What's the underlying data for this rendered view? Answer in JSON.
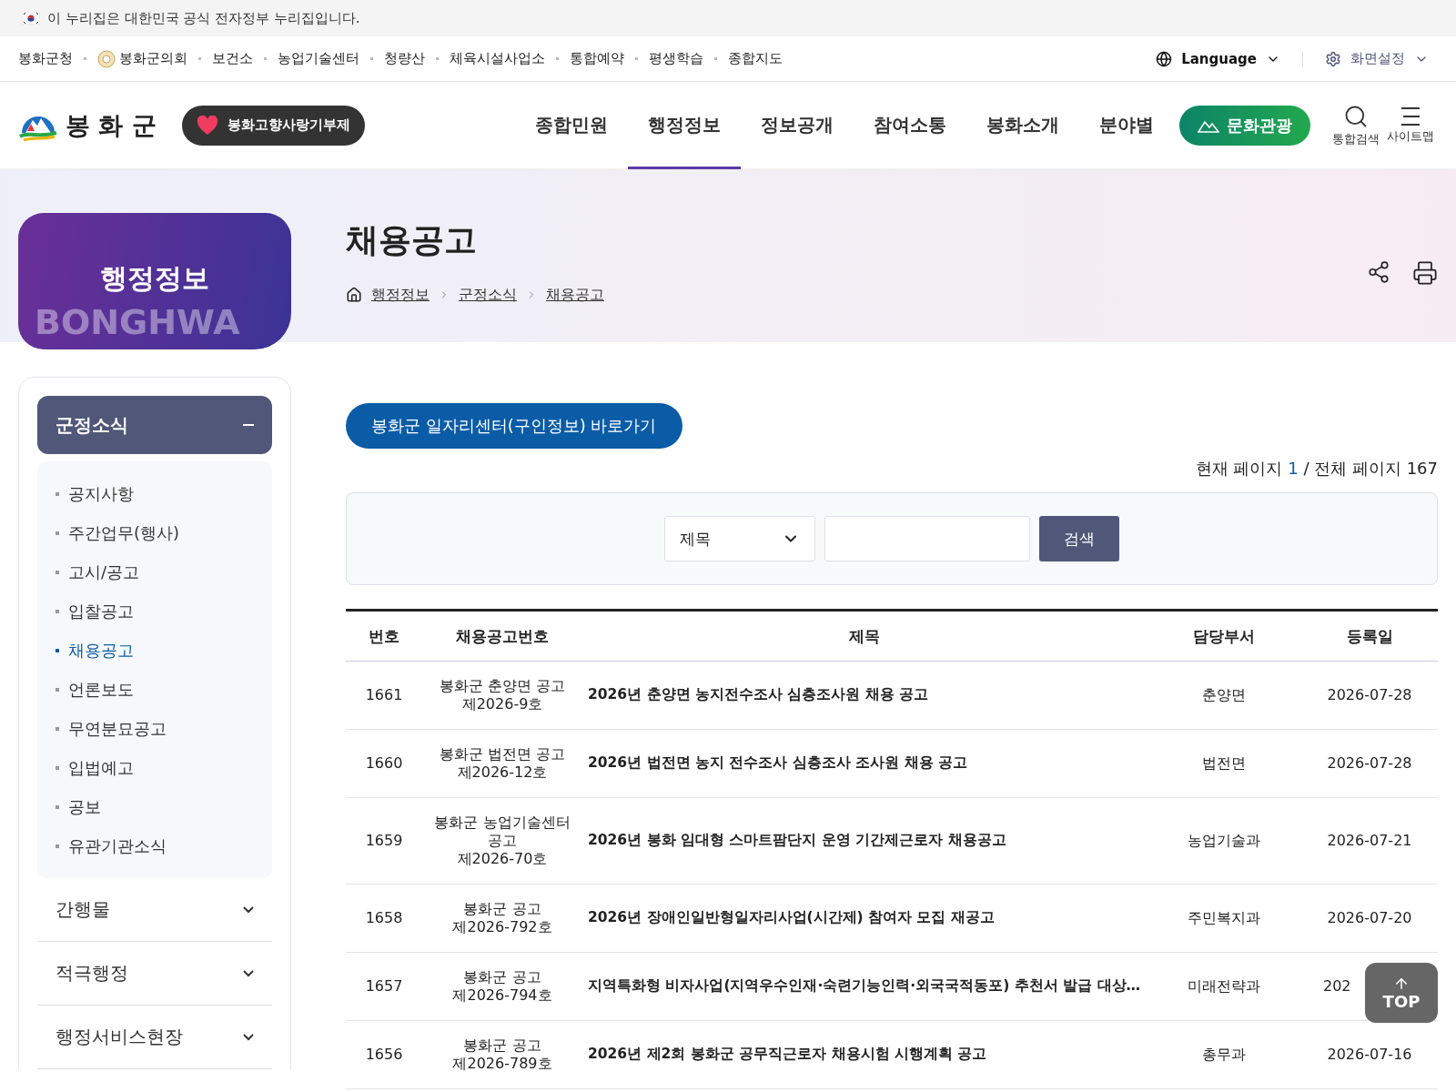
{
  "notice": {
    "text": "이 누리집은 대한민국 공식 전자정부 누리집입니다."
  },
  "family_sites": [
    {
      "label": "봉화군청",
      "kind": "text"
    },
    {
      "label": "봉화군의회",
      "kind": "emblem"
    },
    {
      "label": "보건소",
      "kind": "text"
    },
    {
      "label": "농업기술센터",
      "kind": "text"
    },
    {
      "label": "청량산",
      "kind": "text"
    },
    {
      "label": "체육시설사업소",
      "kind": "text"
    },
    {
      "label": "통합예약",
      "kind": "text"
    },
    {
      "label": "평생학습",
      "kind": "text"
    },
    {
      "label": "종합지도",
      "kind": "text"
    }
  ],
  "utility": {
    "language": "Language",
    "settings": "화면설정"
  },
  "header": {
    "logo": "봉 화 군",
    "donation": "봉화고향사랑기부제",
    "nav": [
      {
        "label": "종합민원",
        "selected": false
      },
      {
        "label": "행정정보",
        "selected": true
      },
      {
        "label": "정보공개",
        "selected": false
      },
      {
        "label": "참여소통",
        "selected": false
      },
      {
        "label": "봉화소개",
        "selected": false
      },
      {
        "label": "분야별",
        "selected": false
      }
    ],
    "culture": "문화관광",
    "search": "통합검색",
    "sitemap": "사이트맵"
  },
  "sidebar": {
    "title": "행정정보",
    "watermark": "BONGHWA",
    "sections": [
      {
        "label": "군정소식",
        "expanded": true,
        "items": [
          {
            "label": "공지사항",
            "selected": false
          },
          {
            "label": "주간업무(행사)",
            "selected": false
          },
          {
            "label": "고시/공고",
            "selected": false
          },
          {
            "label": "입찰공고",
            "selected": false
          },
          {
            "label": "채용공고",
            "selected": true
          },
          {
            "label": "언론보도",
            "selected": false
          },
          {
            "label": "무연분묘공고",
            "selected": false
          },
          {
            "label": "입법예고",
            "selected": false
          },
          {
            "label": "공보",
            "selected": false
          },
          {
            "label": "유관기관소식",
            "selected": false
          }
        ]
      },
      {
        "label": "간행물",
        "expanded": false
      },
      {
        "label": "적극행정",
        "expanded": false
      },
      {
        "label": "행정서비스현장",
        "expanded": false
      }
    ]
  },
  "page": {
    "title": "채용공고",
    "breadcrumb": [
      "행정정보",
      "군정소식",
      "채용공고"
    ],
    "jobs_link": "봉화군 일자리센터(구인정보) 바로가기",
    "paging": {
      "current_label": "현재 페이지",
      "current": "1",
      "total_label": "/ 전체 페이지 167"
    },
    "search": {
      "select": "제목",
      "button": "검색"
    }
  },
  "table": {
    "columns": [
      "번호",
      "채용공고번호",
      "제목",
      "담당부서",
      "등록일"
    ],
    "rows": [
      {
        "no": "1661",
        "notice_no": [
          "봉화군 춘양면 공고",
          "제2026-9호"
        ],
        "title": "2026년 춘양면 농지전수조사 심층조사원 채용 공고",
        "dept": "춘양면",
        "date": "2026-07-28"
      },
      {
        "no": "1660",
        "notice_no": [
          "봉화군 법전면 공고",
          "제2026-12호"
        ],
        "title": "2026년 법전면 농지 전수조사 심층조사 조사원 채용 공고",
        "dept": "법전면",
        "date": "2026-07-28"
      },
      {
        "no": "1659",
        "notice_no": [
          "봉화군 농업기술센터",
          "공고",
          "제2026-70호"
        ],
        "title": "2026년 봉화 임대형 스마트팜단지 운영 기간제근로자 채용공고",
        "dept": "농업기술과",
        "date": "2026-07-21"
      },
      {
        "no": "1658",
        "notice_no": [
          "봉화군 공고",
          "제2026-792호"
        ],
        "title": "2026년 장애인일반형일자리사업(시간제) 참여자 모집 재공고",
        "dept": "주민복지과",
        "date": "2026-07-20"
      },
      {
        "no": "1657",
        "notice_no": [
          "봉화군 공고",
          "제2026-794호"
        ],
        "title": "지역특화형 비자사업(지역우수인재·숙련기능인력·외국국적동포) 추천서 발급 대상…",
        "dept": "미래전략과",
        "date": "202"
      },
      {
        "no": "1656",
        "notice_no": [
          "봉화군 공고",
          "제2026-789호"
        ],
        "title": "2026년 제2회 봉화군 공무직근로자 채용시험 시행계획 공고",
        "dept": "총무과",
        "date": "2026-07-16"
      }
    ]
  },
  "top_button": "TOP"
}
